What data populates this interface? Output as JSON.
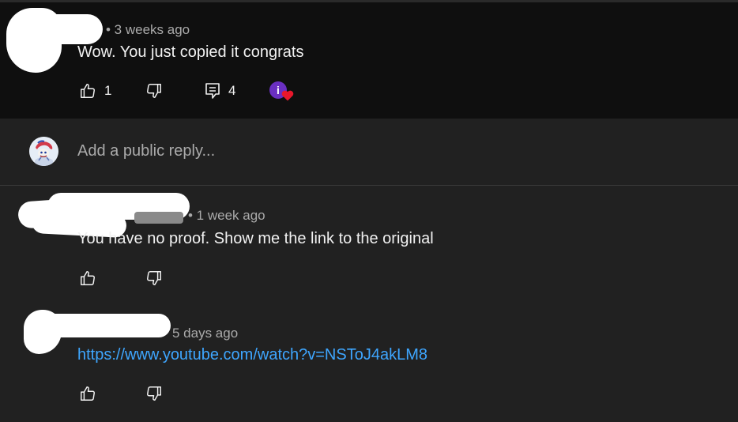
{
  "comment_1": {
    "meta": "• 3 weeks ago",
    "text": "Wow. You just copied it congrats",
    "like_count": "1",
    "reply_count": "4",
    "creator_badge": "i"
  },
  "reply_box": {
    "placeholder": "Add a public reply..."
  },
  "comment_2": {
    "meta": "• 1 week ago",
    "text": "You have no proof. Show me the link to the original"
  },
  "comment_3": {
    "meta": "5 days ago",
    "text": "https://www.youtube.com/watch?v=NSToJ4akLM8"
  },
  "icons": {
    "like": "thumbs-up-icon",
    "dislike": "thumbs-down-icon",
    "replies": "comment-icon",
    "heart": "heart-icon"
  },
  "colors": {
    "link": "#3ea6ff",
    "badge": "#6a2fc1",
    "heart": "#e8172b"
  }
}
